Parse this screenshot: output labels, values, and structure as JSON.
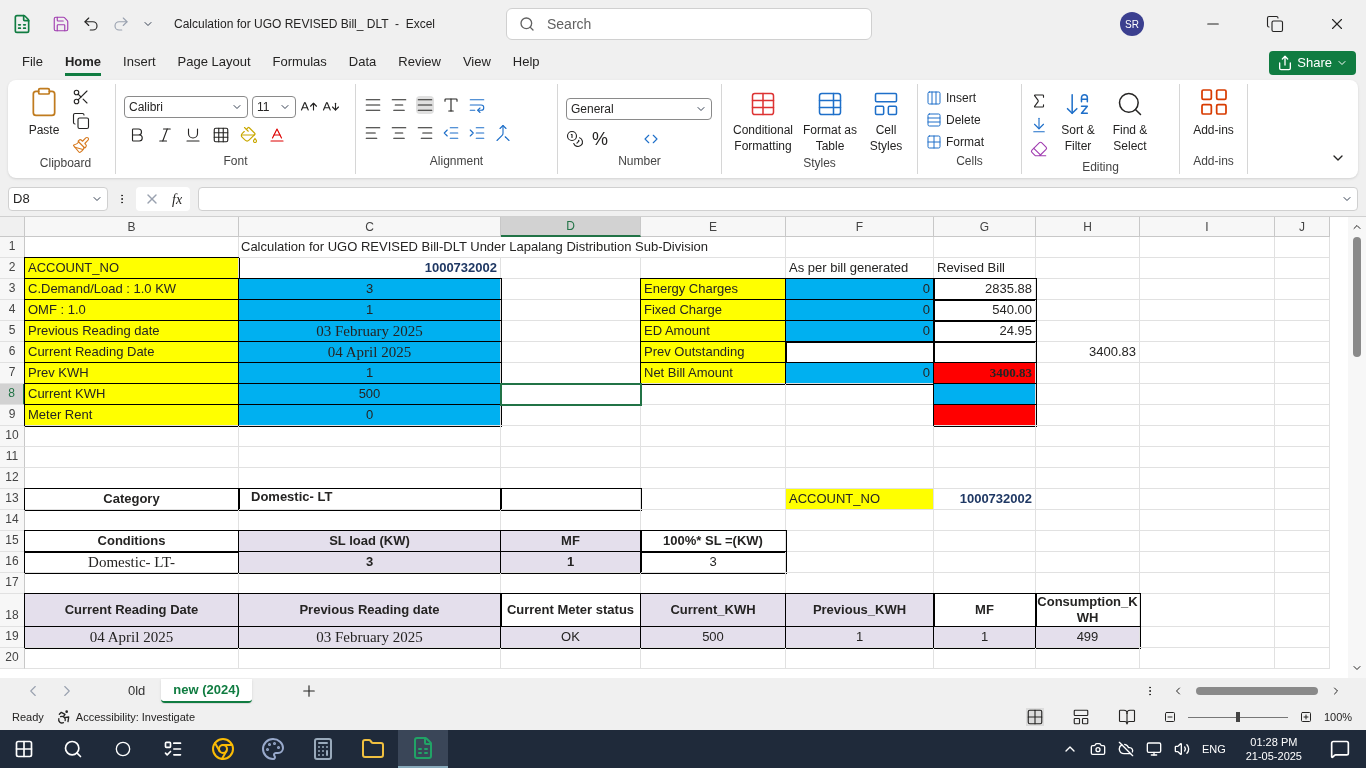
{
  "window": {
    "title": "Calculation for UGO REVISED Bill_ DLT  -  Excel",
    "search_placeholder": "Search",
    "avatar": "SR"
  },
  "menu": [
    {
      "label": "File",
      "selected": false
    },
    {
      "label": "Home",
      "selected": true
    },
    {
      "label": "Insert",
      "selected": false
    },
    {
      "label": "Page Layout",
      "selected": false
    },
    {
      "label": "Formulas",
      "selected": false
    },
    {
      "label": "Data",
      "selected": false
    },
    {
      "label": "Review",
      "selected": false
    },
    {
      "label": "View",
      "selected": false
    },
    {
      "label": "Help",
      "selected": false
    }
  ],
  "share": "Share",
  "ribbon": [
    {
      "kind": "clipboard",
      "label": "Clipboard",
      "buttons": [
        "Paste"
      ]
    },
    {
      "kind": "font",
      "label": "Font",
      "font": "Calibri",
      "size": "11"
    },
    {
      "kind": "alignment",
      "label": "Alignment"
    },
    {
      "kind": "number",
      "label": "Number",
      "format": "General",
      "buttons": [
        "%"
      ]
    },
    {
      "kind": "styles",
      "label": "Styles",
      "buttons": [
        "Conditional Formatting",
        "Format as Table",
        "Cell Styles"
      ]
    },
    {
      "kind": "cells",
      "label": "Cells",
      "buttons": [
        "Insert",
        "Delete",
        "Format"
      ]
    },
    {
      "kind": "editing",
      "label": "Editing",
      "buttons": [
        "Sort & Filter",
        "Find & Select"
      ]
    },
    {
      "kind": "addins",
      "label": "Add-ins",
      "buttons": [
        "Add-ins"
      ]
    }
  ],
  "formula_bar": {
    "name_box": "D8",
    "fx": "fx"
  },
  "columns": [
    {
      "letter": "B",
      "selected": false
    },
    {
      "letter": "C",
      "selected": false
    },
    {
      "letter": "D",
      "selected": true
    },
    {
      "letter": "E",
      "selected": false
    },
    {
      "letter": "F",
      "selected": false
    },
    {
      "letter": "G",
      "selected": false
    },
    {
      "letter": "H",
      "selected": false
    },
    {
      "letter": "I",
      "selected": false
    },
    {
      "letter": "J",
      "selected": false
    }
  ],
  "rows": [
    {
      "number": "1",
      "selected": false,
      "cells": [
        null,
        {
          "text": "Calculation for UGO REVISED Bill-DLT Under Lapalang Distribution Sub-Division",
          "kind": "title"
        },
        null,
        null,
        null,
        null,
        null,
        null,
        null
      ]
    },
    {
      "number": "2",
      "selected": false,
      "cells": [
        {
          "text": "ACCOUNT_NO",
          "kind": "text",
          "color": "#ffff00",
          "bordered": true
        },
        {
          "text": "1000732002",
          "kind": "bold-number"
        },
        null,
        null,
        {
          "text": "As per bill generated",
          "kind": "text"
        },
        {
          "text": "Revised Bill",
          "kind": "text"
        },
        null,
        null,
        null
      ]
    },
    {
      "number": "3",
      "selected": false,
      "cells": [
        {
          "text": "C.Demand/Load : 1.0 KW",
          "kind": "text",
          "color": "#ffff00",
          "bordered": true
        },
        {
          "text": "3",
          "kind": "centered",
          "color": "#00b0f0",
          "bordered": true
        },
        null,
        {
          "text": "Energy Charges",
          "kind": "text",
          "color": "#ffff00",
          "bordered": true
        },
        {
          "text": "0",
          "kind": "number",
          "color": "#00b0f0",
          "bordered": true
        },
        {
          "text": "2835.88",
          "kind": "number",
          "bordered": true
        },
        null,
        null,
        null
      ]
    },
    {
      "number": "4",
      "selected": false,
      "cells": [
        {
          "text": "OMF : 1.0",
          "kind": "text",
          "color": "#ffff00",
          "bordered": true
        },
        {
          "text": "1",
          "kind": "centered",
          "color": "#00b0f0",
          "bordered": true
        },
        null,
        {
          "text": "Fixed Charge",
          "kind": "text",
          "color": "#ffff00",
          "bordered": true
        },
        {
          "text": "0",
          "kind": "number",
          "color": "#00b0f0",
          "bordered": true
        },
        {
          "text": "540.00",
          "kind": "number",
          "bordered": true
        },
        null,
        null,
        null
      ]
    },
    {
      "number": "5",
      "selected": false,
      "cells": [
        {
          "text": "Previous Reading date",
          "kind": "text",
          "color": "#ffff00",
          "bordered": true
        },
        {
          "text": "03 February 2025",
          "kind": "date",
          "color": "#00b0f0",
          "bordered": true
        },
        null,
        {
          "text": "ED Amount",
          "kind": "text",
          "color": "#ffff00",
          "bordered": true
        },
        {
          "text": "0",
          "kind": "number",
          "color": "#00b0f0",
          "bordered": true
        },
        {
          "text": "24.95",
          "kind": "number",
          "bordered": true
        },
        null,
        null,
        null
      ]
    },
    {
      "number": "6",
      "selected": false,
      "cells": [
        {
          "text": "Current Reading Date",
          "kind": "text",
          "color": "#ffff00",
          "bordered": true
        },
        {
          "text": "04 April 2025",
          "kind": "date",
          "color": "#00b0f0",
          "bordered": true
        },
        null,
        {
          "text": "Prev Outstanding",
          "kind": "text",
          "color": "#ffff00",
          "bordered": true
        },
        {
          "kind": "number",
          "bordered": true
        },
        {
          "kind": "number",
          "bordered": true
        },
        {
          "text": "3400.83",
          "kind": "number"
        },
        null,
        null
      ]
    },
    {
      "number": "7",
      "selected": false,
      "cells": [
        {
          "text": "Prev KWH",
          "kind": "text",
          "color": "#ffff00",
          "bordered": true
        },
        {
          "text": "1",
          "kind": "centered",
          "color": "#00b0f0",
          "bordered": true
        },
        null,
        {
          "text": "Net Bill Amount",
          "kind": "text",
          "color": "#ffff00",
          "bordered": true
        },
        {
          "text": "0",
          "kind": "number",
          "color": "#00b0f0",
          "bordered": true
        },
        {
          "text": "3400.83",
          "kind": "total",
          "color": "#ff0000",
          "bordered": true
        },
        null,
        null,
        null
      ]
    },
    {
      "number": "8",
      "selected": true,
      "cells": [
        {
          "text": "Current KWH",
          "kind": "text",
          "color": "#ffff00",
          "bordered": true
        },
        {
          "text": "500",
          "kind": "centered",
          "color": "#00b0f0",
          "bordered": true
        },
        null,
        null,
        null,
        {
          "kind": "number",
          "color": "#00b0f0",
          "bordered": true
        },
        null,
        null,
        null
      ]
    },
    {
      "number": "9",
      "selected": false,
      "cells": [
        {
          "text": "Meter Rent",
          "kind": "text",
          "color": "#ffff00",
          "bordered": true
        },
        {
          "text": "0",
          "kind": "centered",
          "color": "#00b0f0",
          "bordered": true
        },
        null,
        null,
        null,
        {
          "kind": "number",
          "color": "#ff0000",
          "bordered": true
        },
        null,
        null,
        null
      ]
    },
    {
      "number": "10",
      "selected": false,
      "cells": [
        null,
        null,
        null,
        null,
        null,
        null,
        null,
        null,
        null
      ]
    },
    {
      "number": "11",
      "selected": false,
      "cells": [
        null,
        null,
        null,
        null,
        null,
        null,
        null,
        null,
        null
      ]
    },
    {
      "number": "12",
      "selected": false,
      "cells": [
        null,
        null,
        null,
        null,
        null,
        null,
        null,
        null,
        null
      ]
    },
    {
      "number": "13",
      "selected": false,
      "cells": [
        {
          "text": "Category",
          "kind": "heading",
          "bordered": true
        },
        {
          "text": "Domestic- LT",
          "kind": "heading-left",
          "bordered": true
        },
        {
          "kind": "text",
          "bordered": true
        },
        null,
        {
          "text": "ACCOUNT_NO",
          "kind": "text",
          "color": "#ffff00"
        },
        {
          "text": "1000732002",
          "kind": "bold-number"
        },
        null,
        null,
        null
      ]
    },
    {
      "number": "14",
      "selected": false,
      "cells": [
        null,
        null,
        null,
        null,
        null,
        null,
        null,
        null,
        null
      ]
    },
    {
      "number": "15",
      "selected": false,
      "cells": [
        {
          "text": "Conditions",
          "kind": "heading",
          "bordered": true
        },
        {
          "text": "SL load (KW)",
          "kind": "heading",
          "color": "#e4dfec",
          "bordered": true
        },
        {
          "text": "MF",
          "kind": "heading",
          "color": "#e4dfec",
          "bordered": true
        },
        {
          "text": "100%* SL =(KW)",
          "kind": "heading",
          "bordered": true
        },
        null,
        null,
        null,
        null,
        null
      ]
    },
    {
      "number": "16",
      "selected": false,
      "cells": [
        {
          "text": "Domestic- LT-",
          "kind": "serif",
          "bordered": true
        },
        {
          "text": "3",
          "kind": "heading",
          "color": "#e4dfec",
          "bordered": true
        },
        {
          "text": "1",
          "kind": "heading",
          "color": "#e4dfec",
          "bordered": true
        },
        {
          "text": "3",
          "kind": "centered",
          "bordered": true
        },
        null,
        null,
        null,
        null,
        null
      ]
    },
    {
      "number": "17",
      "selected": false,
      "cells": [
        null,
        null,
        null,
        null,
        null,
        null,
        null,
        null,
        null
      ]
    },
    {
      "number": "18",
      "selected": false,
      "cells": [
        {
          "text": "Current Reading Date",
          "kind": "heading",
          "color": "#e4dfec",
          "bordered": true
        },
        {
          "text": "Previous Reading date",
          "kind": "heading",
          "color": "#e4dfec",
          "bordered": true
        },
        {
          "text": "Current Meter status",
          "kind": "heading",
          "bordered": true
        },
        {
          "text": "Current_KWH",
          "kind": "heading",
          "color": "#e4dfec",
          "bordered": true
        },
        {
          "text": "Previous_KWH",
          "kind": "heading",
          "color": "#e4dfec",
          "bordered": true
        },
        {
          "text": "MF",
          "kind": "heading",
          "bordered": true
        },
        {
          "text": "Consumption_KWH",
          "kind": "heading",
          "bordered": true
        },
        null,
        null
      ]
    },
    {
      "number": "19",
      "selected": false,
      "cells": [
        {
          "text": "04 April 2025",
          "kind": "date",
          "color": "#e4dfec",
          "bordered": true
        },
        {
          "text": "03 February 2025",
          "kind": "date",
          "color": "#e4dfec",
          "bordered": true
        },
        {
          "text": "OK",
          "kind": "centered",
          "color": "#e4dfec",
          "bordered": true
        },
        {
          "text": "500",
          "kind": "centered",
          "color": "#e4dfec",
          "bordered": true
        },
        {
          "text": "1",
          "kind": "centered",
          "color": "#e4dfec",
          "bordered": true
        },
        {
          "text": "1",
          "kind": "centered",
          "color": "#e4dfec",
          "bordered": true
        },
        {
          "text": "499",
          "kind": "centered",
          "color": "#e4dfec",
          "bordered": true
        },
        null,
        null
      ]
    },
    {
      "number": "20",
      "selected": false,
      "cells": [
        null,
        null,
        null,
        null,
        null,
        null,
        null,
        null,
        null
      ]
    }
  ],
  "sheet_tabs": [
    {
      "label": "0ld",
      "selected": false
    },
    {
      "label": "new (2024)",
      "selected": true
    }
  ],
  "status_bar": {
    "status": "Ready",
    "accessibility": "Accessibility: Investigate",
    "zoom": "100%",
    "level": 0.5
  },
  "taskbar": {
    "language": "ENG",
    "time": "01:28 PM",
    "date": "21-05-2025"
  }
}
